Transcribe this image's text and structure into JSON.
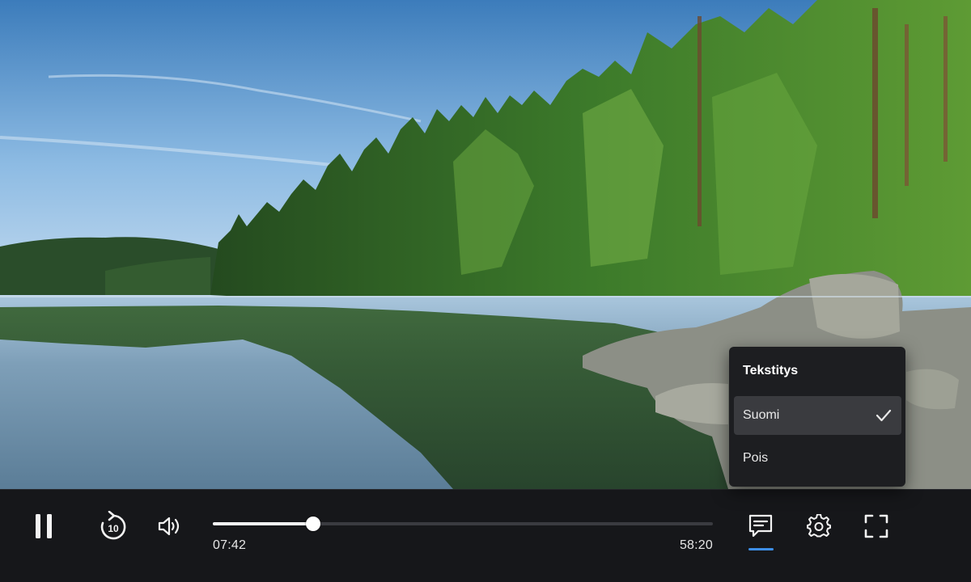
{
  "player": {
    "elapsed": "07:42",
    "duration": "58:20",
    "progress": 0.2
  },
  "subtitles_menu": {
    "title": "Tekstitys",
    "options": [
      {
        "label": "Suomi",
        "selected": true
      },
      {
        "label": "Pois",
        "selected": false
      }
    ]
  },
  "replay_seconds": "10",
  "colors": {
    "accent": "#3d8ee6",
    "bar_background": "#16171a",
    "menu_background": "#1d1e21",
    "menu_selected": "#3a3b3f"
  },
  "icons": {
    "play_pause": "pause-icon",
    "replay": "replay-10-icon",
    "volume": "volume-icon",
    "subtitles": "subtitles-icon",
    "settings": "gear-icon",
    "fullscreen": "fullscreen-icon",
    "check": "check-icon"
  }
}
